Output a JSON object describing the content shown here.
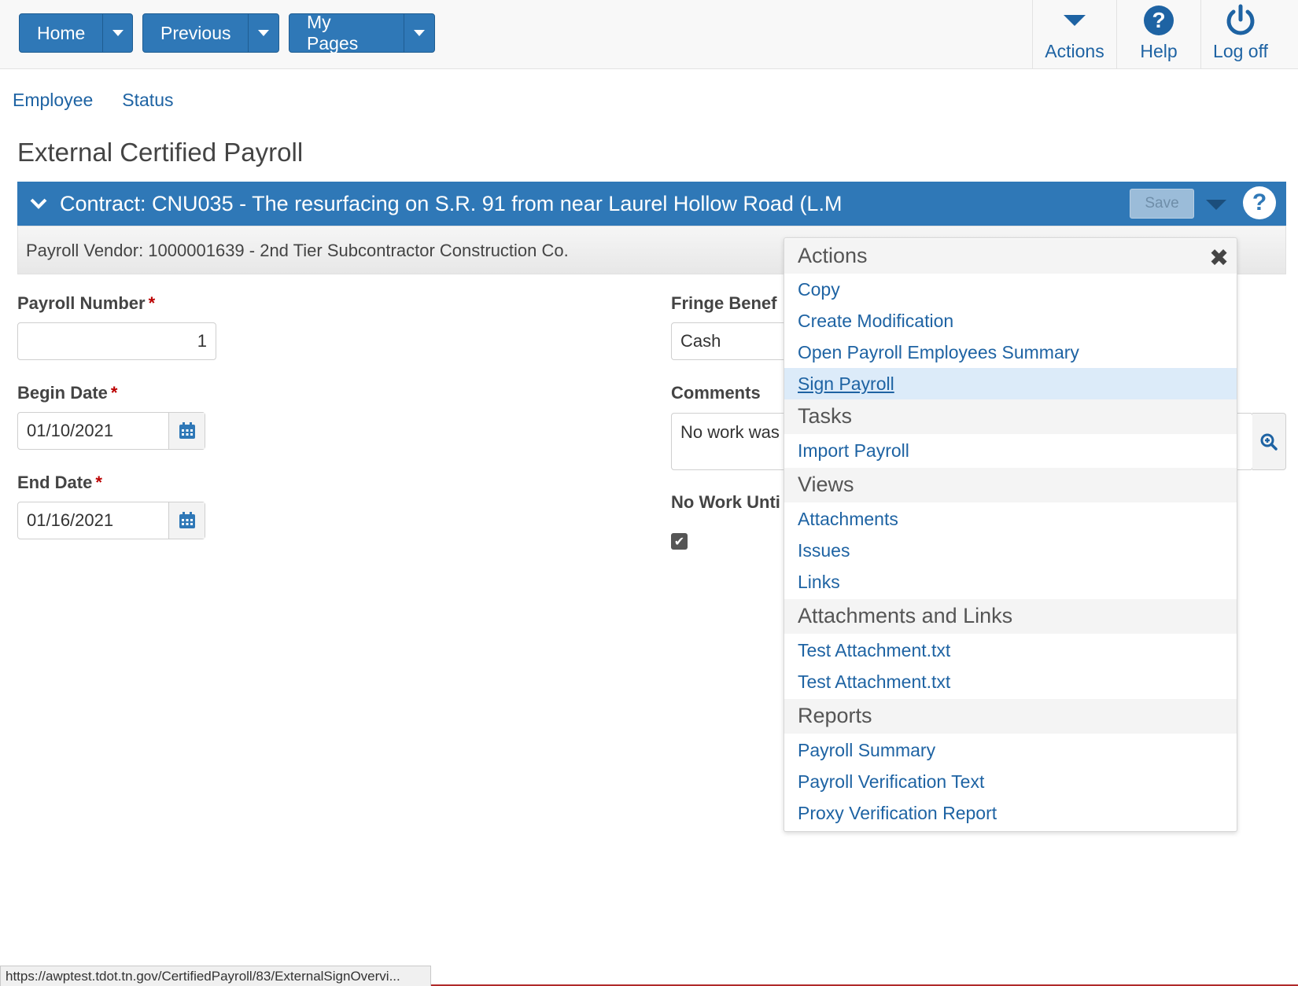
{
  "nav": {
    "home": "Home",
    "previous": "Previous",
    "my_pages": "My Pages",
    "actions": "Actions",
    "help": "Help",
    "log_off": "Log off"
  },
  "breadcrumbs": [
    "Employee",
    "Status"
  ],
  "page_title": "External Certified Payroll",
  "contract": {
    "title": "Contract: CNU035 - The resurfacing on S.R. 91 from near Laurel Hollow Road (L.M",
    "save_label": "Save",
    "vendor": "Payroll Vendor: 1000001639 - 2nd Tier Subcontractor Construction Co."
  },
  "form": {
    "payroll_number_label": "Payroll Number",
    "payroll_number_value": "1",
    "begin_date_label": "Begin Date",
    "begin_date_value": "01/10/2021",
    "end_date_label": "End Date",
    "end_date_value": "01/16/2021",
    "fringe_label": "Fringe Benef",
    "fringe_value": "Cash",
    "comments_label": "Comments",
    "comments_value": "No work was",
    "no_work_label": "No Work Unti",
    "no_work_checked": true,
    "required_mark": "*"
  },
  "menu": {
    "close_glyph": "✖",
    "sections": [
      {
        "title": "Actions",
        "items": [
          "Copy",
          "Create Modification",
          "Open Payroll Employees Summary",
          "Sign Payroll"
        ]
      },
      {
        "title": "Tasks",
        "items": [
          "Import Payroll"
        ]
      },
      {
        "title": "Views",
        "items": [
          "Attachments",
          "Issues",
          "Links"
        ]
      },
      {
        "title": "Attachments and Links",
        "items": [
          "Test Attachment.txt",
          "Test Attachment.txt"
        ]
      },
      {
        "title": "Reports",
        "items": [
          "Payroll Summary",
          "Payroll Verification Text",
          "Proxy Verification Report"
        ]
      }
    ]
  },
  "status_url": "https://awptest.tdot.tn.gov/CertifiedPayroll/83/ExternalSignOvervi...",
  "colors": {
    "primary": "#2f78b7",
    "link": "#1e63a3",
    "highlight": "#dcebf9",
    "required": "#bb0000"
  }
}
